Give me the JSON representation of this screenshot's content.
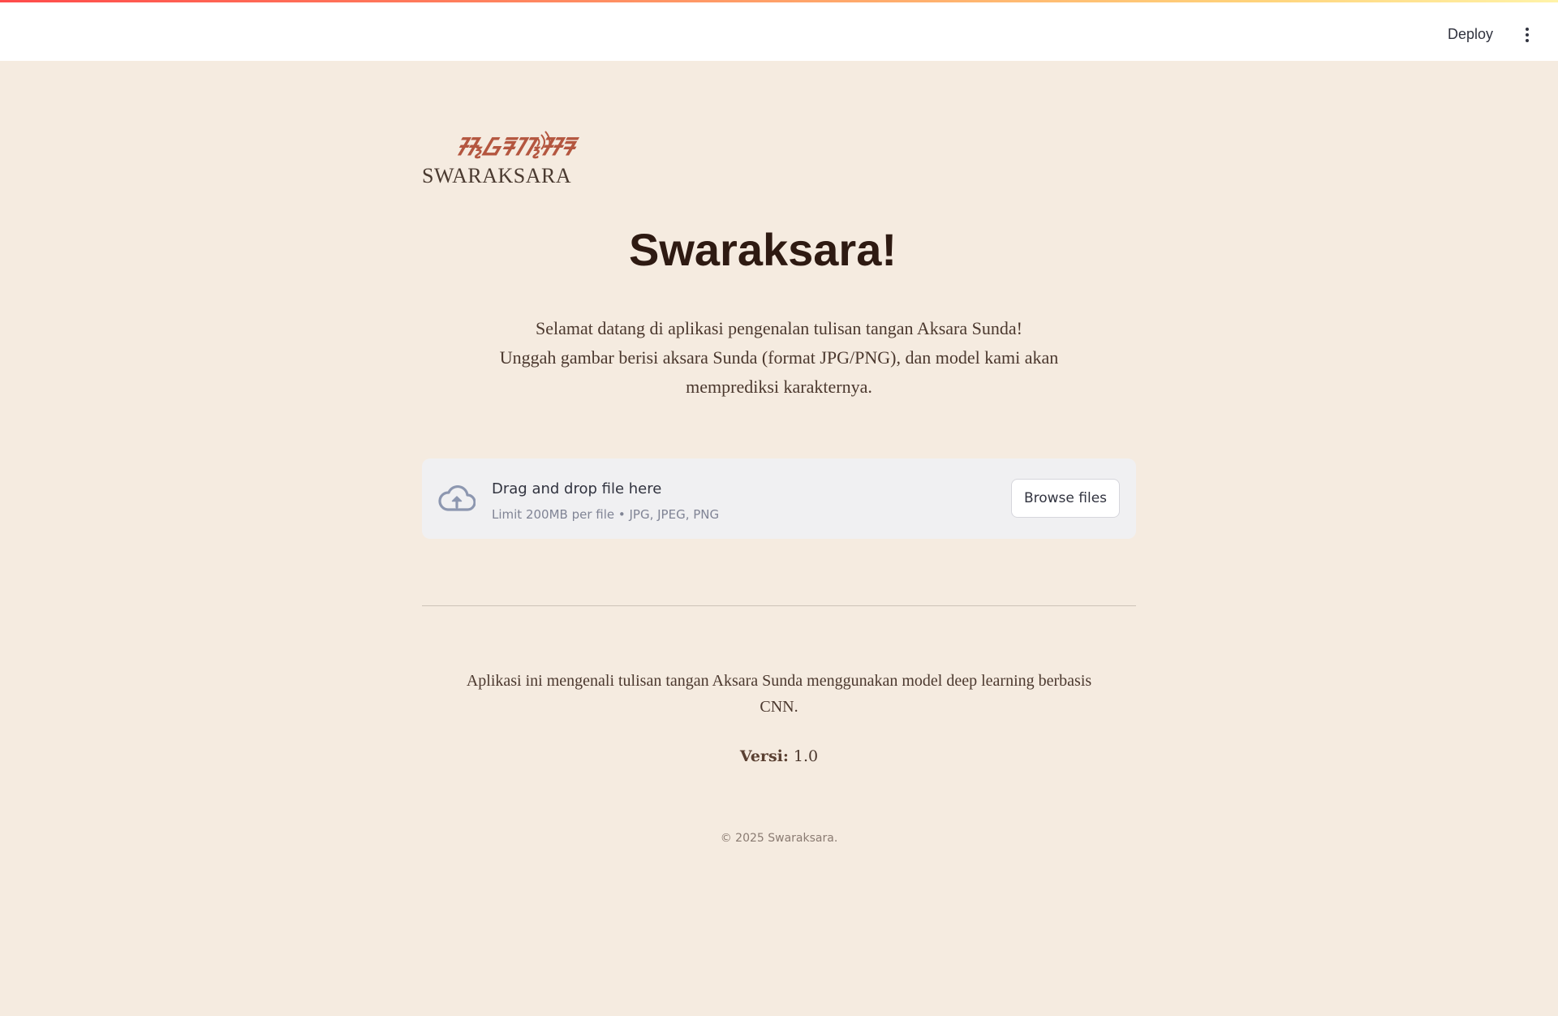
{
  "header": {
    "deploy_label": "Deploy",
    "menu_icon": "kebab-menu-icon"
  },
  "logo": {
    "script_text": "ᮞ᮪ᮝᮛᮊ᮪ᮞᮛ",
    "wordmark": "SWARAKSARA",
    "accent_color": "#b4563f"
  },
  "main": {
    "title": "Swaraksara!",
    "intro_line1": "Selamat datang di aplikasi pengenalan tulisan tangan Aksara Sunda!",
    "intro_line2": "Unggah gambar berisi aksara Sunda (format JPG/PNG), dan model kami akan memprediksi karakternya."
  },
  "uploader": {
    "icon": "cloud-upload-icon",
    "drop_text": "Drag and drop file here",
    "limit_text": "Limit 200MB per file • JPG, JPEG, PNG",
    "browse_label": "Browse files"
  },
  "about": {
    "description": "Aplikasi ini mengenali tulisan tangan Aksara Sunda menggunakan model deep learning berbasis CNN.",
    "version_label": "Versi:",
    "version_value": "1.0"
  },
  "footer": {
    "copyright": "© 2025 Swaraksara."
  },
  "colors": {
    "background": "#f5ebe0",
    "title": "#2e1a12",
    "text": "#4b382e"
  }
}
